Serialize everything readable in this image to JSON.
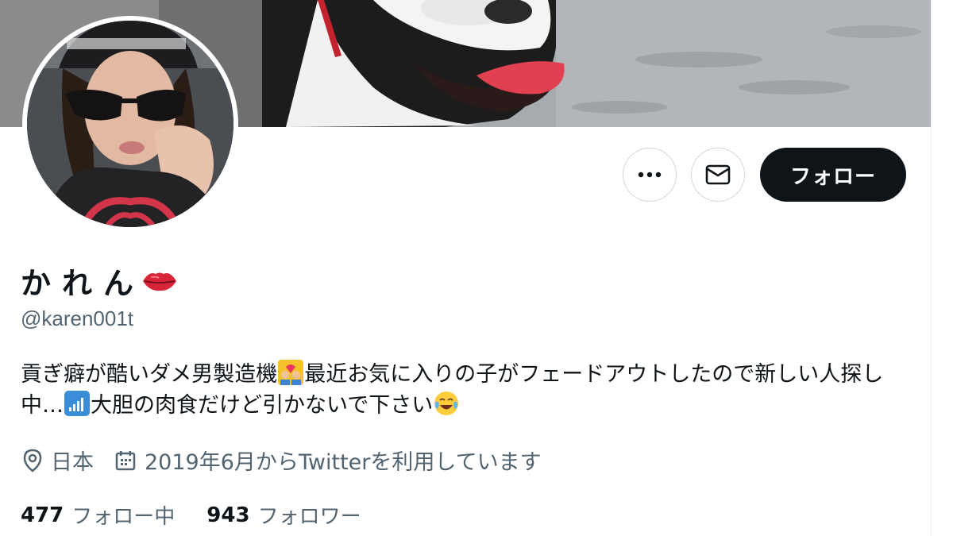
{
  "profile": {
    "display_name": "かれん",
    "handle": "@karen001t",
    "bio_part1": "貢ぎ癖が酷いダメ男製造機",
    "bio_part2": "最近お気に入りの子がフェードアウトしたので新しい人探し中…",
    "bio_part3": "大胆の肉食だけど引かないで下さい",
    "location": "日本",
    "joined": "2019年6月からTwitterを利用しています"
  },
  "actions": {
    "more_icon": "more-icon",
    "message_icon": "envelope-icon",
    "follow_label": "フォロー"
  },
  "stats": {
    "following_count": "477",
    "following_label": "フォロー中",
    "followers_count": "943",
    "followers_label": "フォロワー"
  },
  "icons": {
    "name_emoji": "kiss-mark-icon",
    "bio_emoji_1": "couple-with-heart-icon",
    "bio_emoji_2": "antenna-bars-icon",
    "bio_emoji_3": "tears-of-joy-icon",
    "location": "location-pin-icon",
    "calendar": "calendar-icon"
  },
  "colors": {
    "text_primary": "#0f1419",
    "text_secondary": "#536471",
    "follow_button_bg": "#0f1419",
    "button_border": "#cfd9de"
  }
}
